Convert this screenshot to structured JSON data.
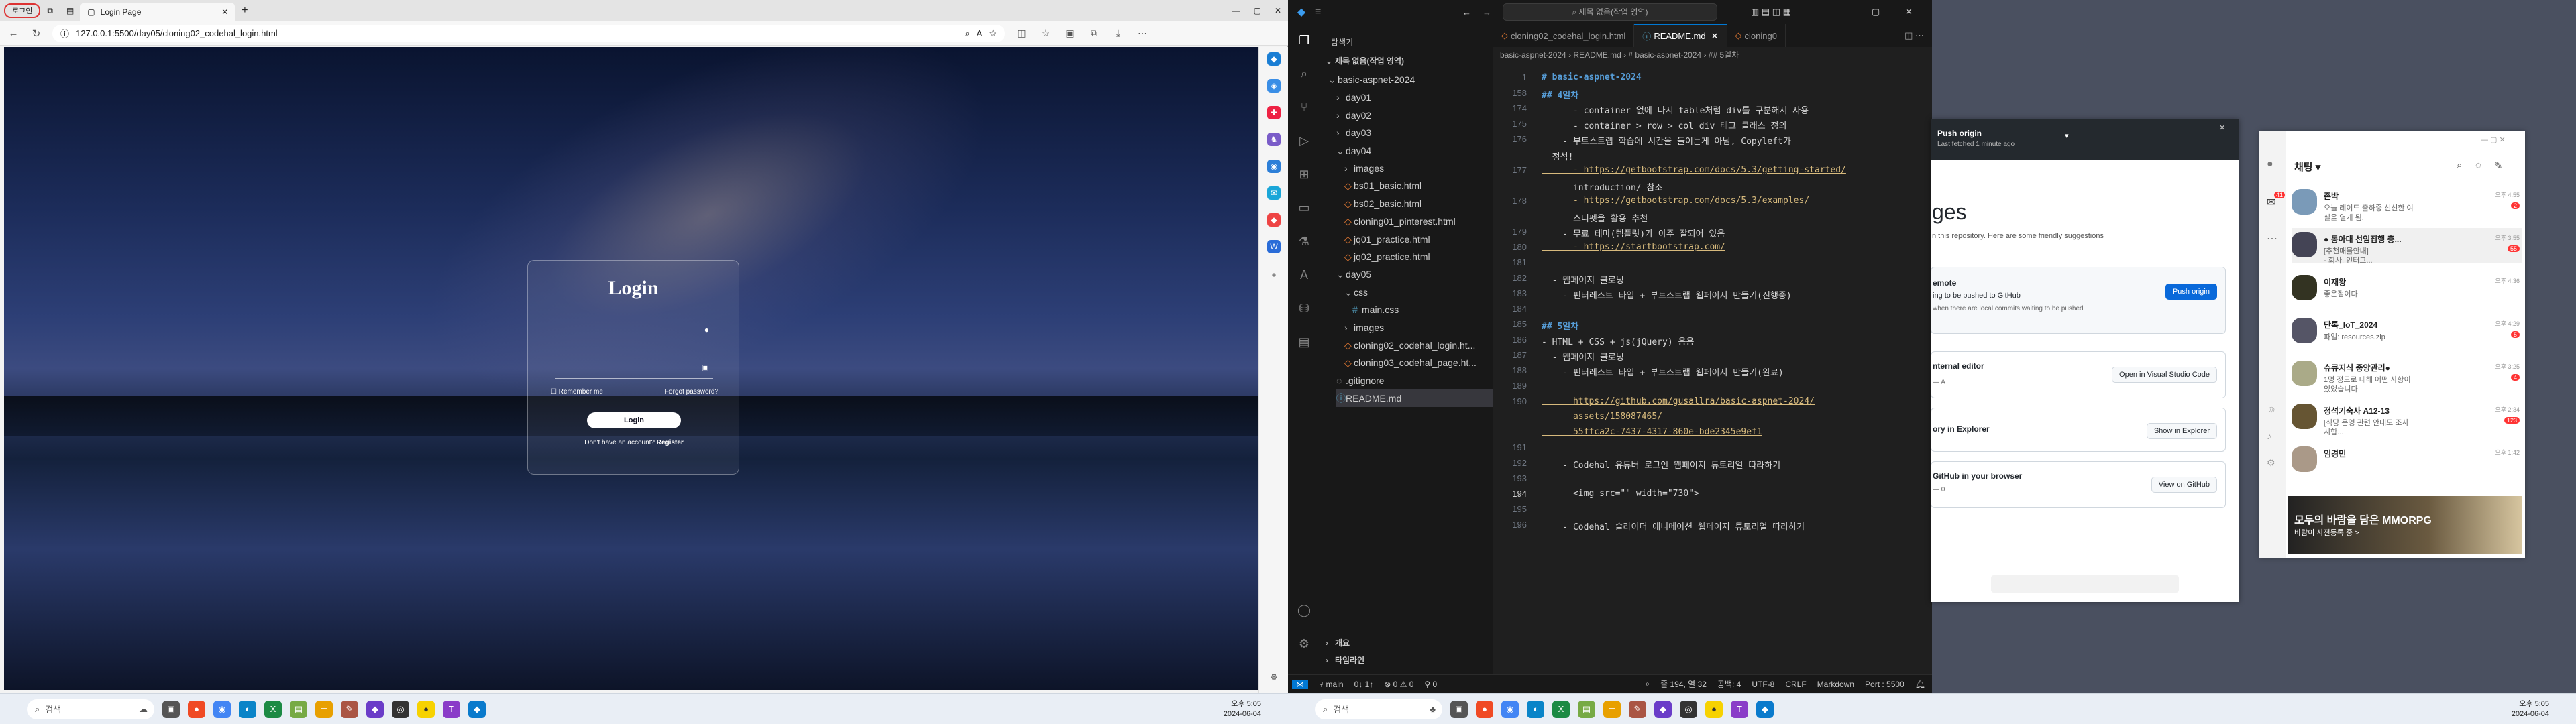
{
  "browser": {
    "profile": "로그인",
    "tab_title": "Login Page",
    "url": "127.0.0.1:5500/day05/cloning02_codehal_login.html",
    "login": {
      "title": "Login",
      "remember": "Remember me",
      "forgot": "Forgot password?",
      "button": "Login",
      "no_account": "Don't have an account?",
      "register": "Register"
    }
  },
  "vscode": {
    "search": "제목 없음(작업 영역)",
    "explorer_title": "탐색기",
    "workspace": "제목 없음(작업 영역)",
    "tree": [
      {
        "label": "basic-aspnet-2024",
        "depth": 1,
        "kind": "open"
      },
      {
        "label": "day01",
        "depth": 2,
        "kind": "closed"
      },
      {
        "label": "day02",
        "depth": 2,
        "kind": "closed"
      },
      {
        "label": "day03",
        "depth": 2,
        "kind": "closed"
      },
      {
        "label": "day04",
        "depth": 2,
        "kind": "open"
      },
      {
        "label": "images",
        "depth": 3,
        "kind": "closed"
      },
      {
        "label": "bs01_basic.html",
        "depth": 3,
        "kind": "html"
      },
      {
        "label": "bs02_basic.html",
        "depth": 3,
        "kind": "html"
      },
      {
        "label": "cloning01_pinterest.html",
        "depth": 3,
        "kind": "html"
      },
      {
        "label": "jq01_practice.html",
        "depth": 3,
        "kind": "html"
      },
      {
        "label": "jq02_practice.html",
        "depth": 3,
        "kind": "html"
      },
      {
        "label": "day05",
        "depth": 2,
        "kind": "open"
      },
      {
        "label": "css",
        "depth": 3,
        "kind": "open"
      },
      {
        "label": "main.css",
        "depth": 4,
        "kind": "css"
      },
      {
        "label": "images",
        "depth": 3,
        "kind": "closed"
      },
      {
        "label": "cloning02_codehal_login.ht...",
        "depth": 3,
        "kind": "html"
      },
      {
        "label": "cloning03_codehal_page.ht...",
        "depth": 3,
        "kind": "html"
      },
      {
        "label": ".gitignore",
        "depth": 2,
        "kind": "file"
      },
      {
        "label": "README.md",
        "depth": 2,
        "kind": "md"
      }
    ],
    "outline": "개요",
    "timeline": "타임라인",
    "tabs": [
      "cloning02_codehal_login.html",
      "README.md",
      "cloning0"
    ],
    "breadcrumb": "basic-aspnet-2024 › README.md › # basic-aspnet-2024 › ## 5일차",
    "lines": [
      {
        "n": "1",
        "t": "# basic-aspnet-2024",
        "c": "h"
      },
      {
        "n": "158",
        "t": "## 4일차",
        "c": "h"
      },
      {
        "n": "174",
        "t": "      - container 없에 다시 table처럼 div를 구분해서 사용",
        "c": ""
      },
      {
        "n": "175",
        "t": "      - container > row > col div 태그 클래스 정의",
        "c": ""
      },
      {
        "n": "176",
        "t": "    - 부트스트랩 학습에 시간을 들이는게 아님, Copyleft가",
        "c": ""
      },
      {
        "n": "",
        "t": "  정석!",
        "c": ""
      },
      {
        "n": "177",
        "t": "      - https://getbootstrap.com/docs/5.3/getting-started/",
        "c": "lk"
      },
      {
        "n": "",
        "t": "      introduction/ 참조",
        "c": ""
      },
      {
        "n": "178",
        "t": "      - https://getbootstrap.com/docs/5.3/examples/",
        "c": "lk"
      },
      {
        "n": "",
        "t": "      스니펫을 활용 추천",
        "c": ""
      },
      {
        "n": "179",
        "t": "    - 무료 테마(템플릿)가 아주 잘되어 있음",
        "c": ""
      },
      {
        "n": "180",
        "t": "      - https://startbootstrap.com/",
        "c": "lk"
      },
      {
        "n": "181",
        "t": "",
        "c": ""
      },
      {
        "n": "182",
        "t": "  - 웹페이지 클로닝",
        "c": ""
      },
      {
        "n": "183",
        "t": "    - 핀터레스트 타입 + 부트스트랩 웹페이지 만들기(진행중)",
        "c": ""
      },
      {
        "n": "184",
        "t": "",
        "c": ""
      },
      {
        "n": "185",
        "t": "## 5일차",
        "c": "h"
      },
      {
        "n": "186",
        "t": "- HTML + CSS + js(jQuery) 응용",
        "c": ""
      },
      {
        "n": "187",
        "t": "  - 웹페이지 클로닝",
        "c": ""
      },
      {
        "n": "188",
        "t": "    - 핀터레스트 타입 + 부트스트랩 웹페이지 만들기(완료)",
        "c": ""
      },
      {
        "n": "189",
        "t": "",
        "c": ""
      },
      {
        "n": "190",
        "t": "      https://github.com/gusallra/basic-aspnet-2024/",
        "c": "lk"
      },
      {
        "n": "",
        "t": "      assets/158087465/",
        "c": "lk"
      },
      {
        "n": "",
        "t": "      55ffca2c-7437-4317-860e-bde2345e9ef1",
        "c": "lk"
      },
      {
        "n": "191",
        "t": "",
        "c": ""
      },
      {
        "n": "192",
        "t": "    - Codehal 유튜버 로그인 웹페이지 튜토리얼 따라하기",
        "c": ""
      },
      {
        "n": "193",
        "t": "",
        "c": ""
      },
      {
        "n": "194",
        "t": "      <img src=\"\" width=\"730\">",
        "c": ""
      },
      {
        "n": "195",
        "t": "",
        "c": ""
      },
      {
        "n": "196",
        "t": "    - Codehal 슬라이더 애니메이션 웹페이지 튜토리얼 따라하기",
        "c": ""
      }
    ],
    "status": {
      "branch": "main",
      "sync": "0↓ 1↑",
      "problems": "⊗ 0 ⚠ 0",
      "ports": "0",
      "position": "줄 194, 열 32",
      "spaces": "공백: 4",
      "encoding": "UTF-8",
      "eol": "CRLF",
      "language": "Markdown",
      "port": "Port : 5500"
    }
  },
  "github": {
    "push_title": "Push origin",
    "push_sub": "Last fetched 1 minute ago",
    "heading": "ges",
    "sub": "n this repository. Here are some friendly suggestions",
    "remote_title": "emote",
    "remote_text": "ing to be pushed to GitHub",
    "remote_text2": "when there are local commits waiting to be pushed",
    "push_btn": "Push origin",
    "editor_title": "nternal editor",
    "editor_btn": "Open in Visual Studio Code",
    "explorer_title": "ory in Explorer",
    "explorer_btn": "Show in Explorer",
    "browser_title": "GitHub in your browser",
    "browser_btn": "View on GitHub",
    "cmd_a": "— A",
    "cmd_b": "— 0"
  },
  "chat": {
    "title": "채팅",
    "badge": "41",
    "items": [
      {
        "name": "존박",
        "msg": "오늘 레이드 출하중 신신한 여",
        "msg2": "실을 열게 됨.",
        "time": "오후 4:55",
        "badge": "2"
      },
      {
        "name": "● 동아대 선임집행 총...",
        "msg": "[추천매물안내]",
        "msg2": "- 회사: 인터그...",
        "time": "오후 3:55",
        "badge": "55"
      },
      {
        "name": "이재왕",
        "msg": "좋은점이다",
        "msg2": "",
        "time": "오후 4:36",
        "badge": ""
      },
      {
        "name": "단톡_IoT_2024",
        "msg": "파일: resources.zip",
        "msg2": "",
        "time": "오후 4:29",
        "badge": "5"
      },
      {
        "name": "슈큐지식 중앙관리●",
        "msg": "1명 정도로 대해 어떤 사항이",
        "msg2": "있었습니다",
        "time": "오후 3:25",
        "badge": "4"
      },
      {
        "name": "정석기숙사 A12-13",
        "msg": "[식당 운영 관련 안내도 조사",
        "msg2": "시합...",
        "time": "오후 2:34",
        "badge": "123"
      },
      {
        "name": "임경민",
        "msg": "",
        "msg2": "",
        "time": "오후 1:42",
        "badge": ""
      }
    ],
    "ad_title": "모두의 바람을 담은 MMORPG",
    "ad_sub": "바람이 사전등록 중 >"
  },
  "taskbar_left": {
    "search": "검색",
    "time": "오후 5:05",
    "date": "2024-06-04"
  },
  "taskbar_right": {
    "search": "검색",
    "time": "오후 5:05",
    "date": "2024-06-04"
  },
  "colors": {
    "vscode_accent": "#0078d4",
    "login_button": "#ffffff",
    "ghd_blue": "#0969da"
  }
}
